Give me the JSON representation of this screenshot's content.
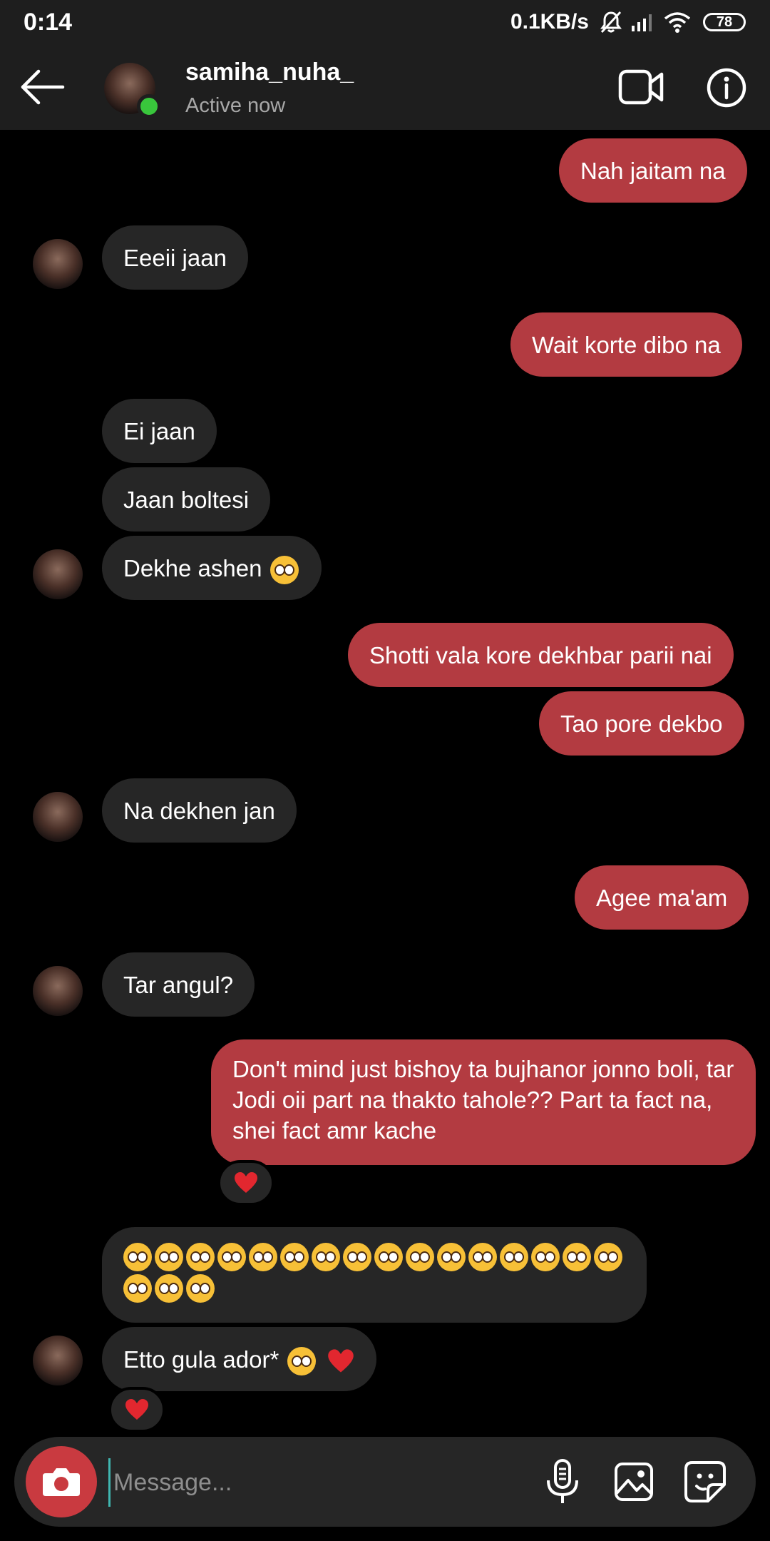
{
  "status_bar": {
    "time": "0:14",
    "speed": "0.1KB/s",
    "battery": "78"
  },
  "header": {
    "username": "samiha_nuha_",
    "status": "Active now"
  },
  "messages": [
    {
      "side": "sent",
      "text": "Nah jaitam na"
    },
    {
      "side": "recv",
      "text": "Eeeii jaan"
    },
    {
      "side": "sent",
      "text": "Wait korte dibo na"
    },
    {
      "side": "recv",
      "text": "Ei jaan"
    },
    {
      "side": "recv",
      "text": "Jaan boltesi"
    },
    {
      "side": "recv",
      "text": "Dekhe ashen"
    },
    {
      "side": "sent",
      "text": "Shotti vala kore dekhbar parii nai"
    },
    {
      "side": "sent",
      "text": "Tao pore dekbo"
    },
    {
      "side": "recv",
      "text": "Na dekhen jan"
    },
    {
      "side": "sent",
      "text": "Agee ma'am"
    },
    {
      "side": "recv",
      "text": "Tar angul?"
    },
    {
      "side": "sent",
      "text": "Don't mind just bishoy ta bujhanor jonno boli, tar Jodi oii part na thakto tahole?? Part ta fact na, shei fact amr kache"
    },
    {
      "side": "recv",
      "text": ""
    },
    {
      "side": "recv",
      "text": "Etto gula ador*"
    }
  ],
  "composer": {
    "placeholder": "Message..."
  },
  "colors": {
    "sent_bubble": "#b33b41",
    "received_bubble": "#262626",
    "online": "#39c63c",
    "camera_button": "#c93a40"
  }
}
